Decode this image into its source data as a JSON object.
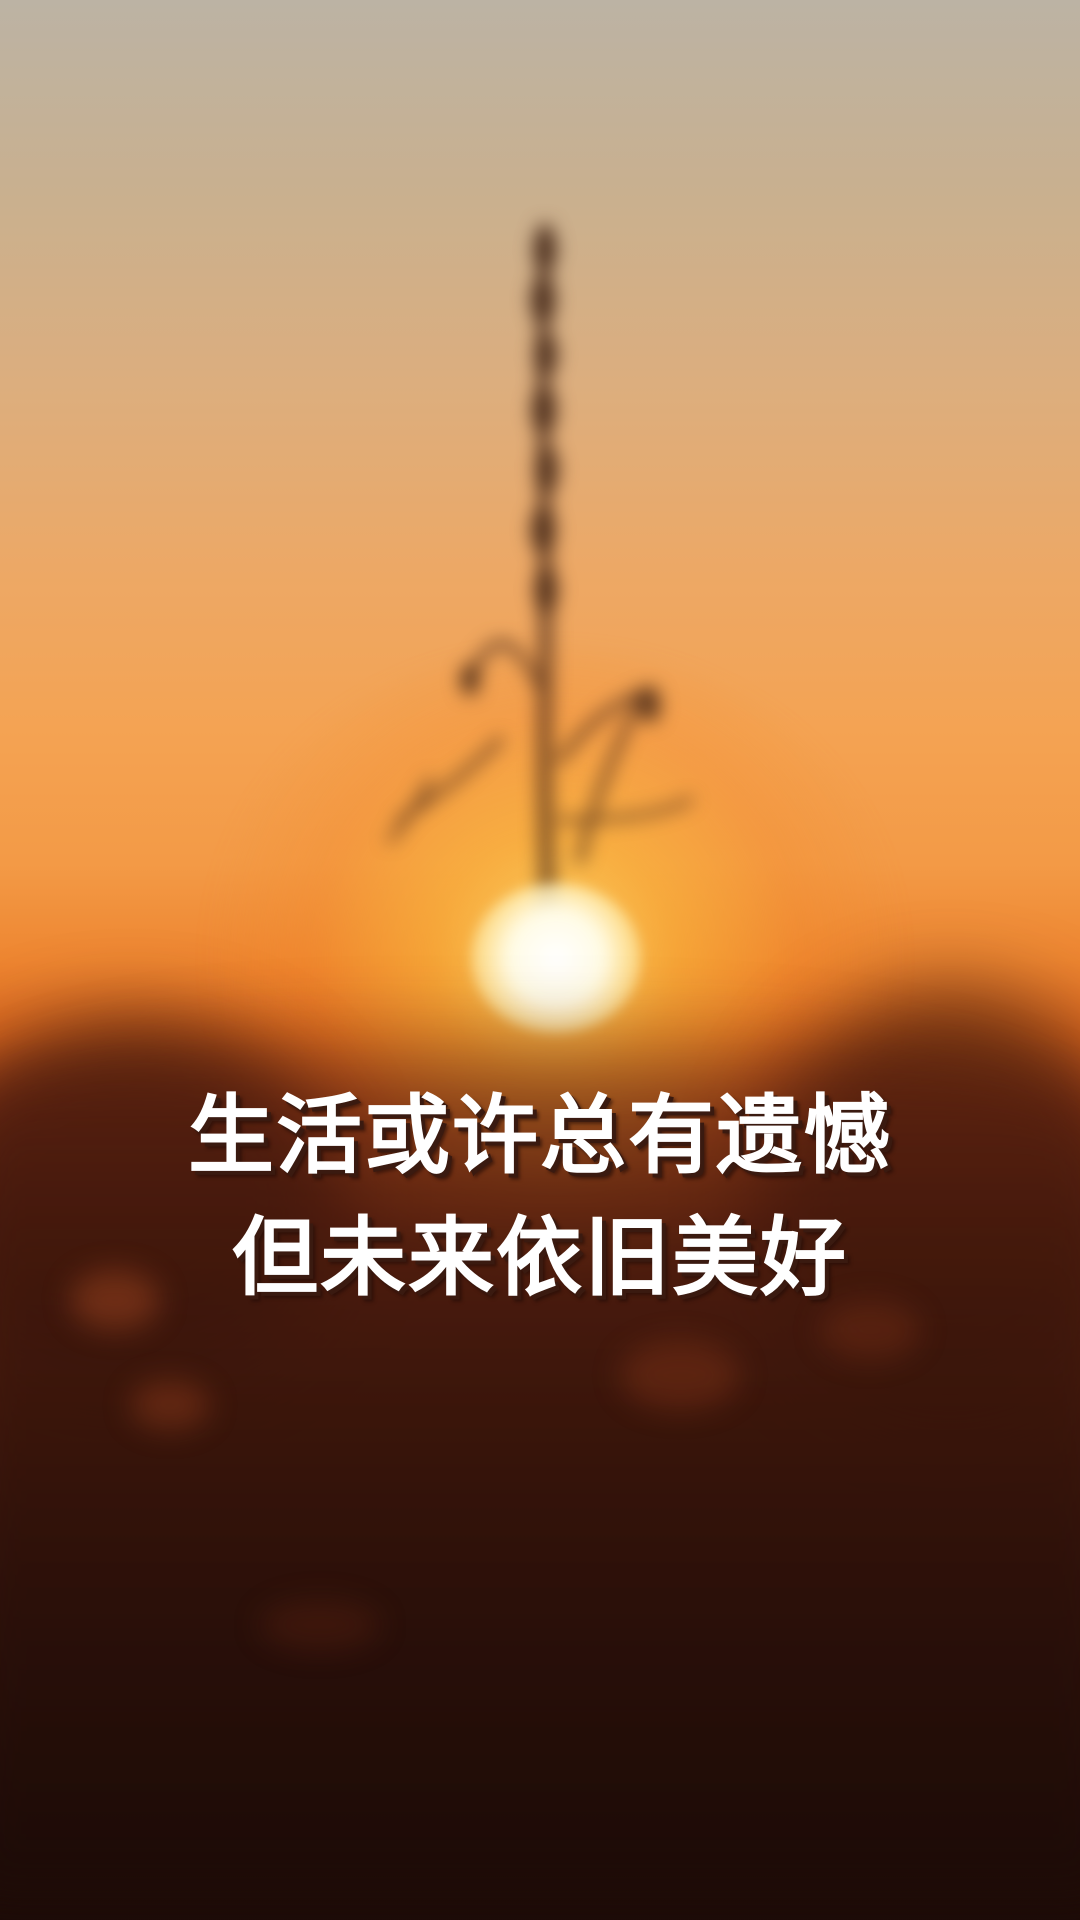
{
  "quote": {
    "line1": "生活或许总有遗憾",
    "line2": "但未来依旧美好"
  },
  "colors": {
    "sky_top": "#bcb3a4",
    "sky_mid": "#f4a353",
    "horizon": "#e06a20",
    "ground": "#2a100a",
    "sun": "#fffbe6",
    "text": "#ffffff",
    "text_shadow": "#3a1a10"
  }
}
